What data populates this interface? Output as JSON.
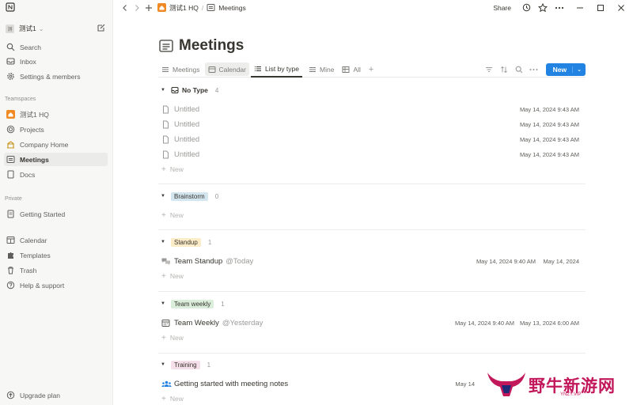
{
  "sidebar": {
    "workspace_avatar": "测",
    "workspace_name": "测试1",
    "items_top": [
      {
        "label": "Search"
      },
      {
        "label": "Inbox"
      },
      {
        "label": "Settings & members"
      }
    ],
    "teamspaces_heading": "Teamspaces",
    "teamspace_name": "测试1 HQ",
    "teamspace_items": [
      {
        "label": "Projects"
      },
      {
        "label": "Company Home"
      },
      {
        "label": "Meetings"
      },
      {
        "label": "Docs"
      }
    ],
    "private_heading": "Private",
    "private_items": [
      {
        "label": "Getting Started"
      }
    ],
    "bottom_items": [
      {
        "label": "Calendar"
      },
      {
        "label": "Templates"
      },
      {
        "label": "Trash"
      },
      {
        "label": "Help & support"
      }
    ],
    "upgrade_label": "Upgrade plan"
  },
  "topbar": {
    "breadcrumb_workspace": "测试1 HQ",
    "breadcrumb_sep": "/",
    "breadcrumb_page": "Meetings",
    "share_label": "Share"
  },
  "page": {
    "title": "Meetings"
  },
  "views": {
    "tabs": [
      {
        "label": "Meetings"
      },
      {
        "label": "Calendar"
      },
      {
        "label": "List by type"
      },
      {
        "label": "Mine"
      },
      {
        "label": "All"
      }
    ],
    "new_label": "New"
  },
  "groups": {
    "no_type": {
      "label": "No Type",
      "count": "4",
      "rows": [
        {
          "name": "Untitled",
          "created": "May 14, 2024 9:43 AM"
        },
        {
          "name": "Untitled",
          "created": "May 14, 2024 9:43 AM"
        },
        {
          "name": "Untitled",
          "created": "May 14, 2024 9:43 AM"
        },
        {
          "name": "Untitled",
          "created": "May 14, 2024 9:43 AM"
        }
      ]
    },
    "brainstorm": {
      "label": "Brainstorm",
      "count": "0"
    },
    "standup": {
      "label": "Standup",
      "count": "1",
      "rows": [
        {
          "name": "Team Standup",
          "mention": "@Today",
          "created": "May 14, 2024 9:40 AM",
          "date": "May 14, 2024"
        }
      ]
    },
    "weekly": {
      "label": "Team weekly",
      "count": "1",
      "rows": [
        {
          "name": "Team Weekly",
          "mention": "@Yesterday",
          "created": "May 14, 2024 9:40 AM",
          "date": "May 13, 2024 6:00 AM"
        }
      ]
    },
    "training": {
      "label": "Training",
      "count": "1",
      "rows": [
        {
          "name": "Getting started with meeting notes",
          "created": "May 14"
        }
      ]
    },
    "new_label": "New"
  },
  "colors": {
    "brainstorm_tag": "#d3e5ef",
    "standup_tag": "#fdecc8",
    "weekly_tag": "#dbeddb",
    "training_tag": "#f5e0e9",
    "accent": "#2383e2"
  },
  "watermark": {
    "text": "野牛新游网",
    "sub": "YNZY.VIP"
  }
}
